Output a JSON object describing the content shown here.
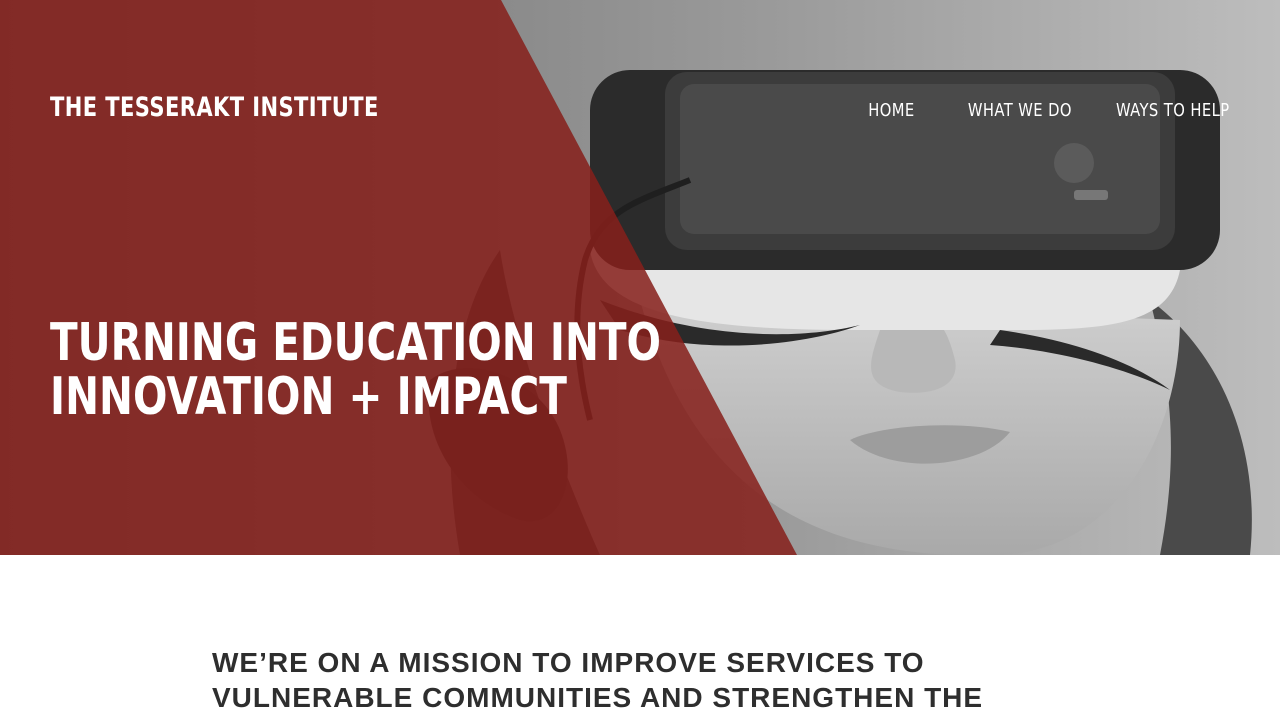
{
  "brand": {
    "logo_text": "THE TESSERAKT INSTITUTE"
  },
  "nav": {
    "items": [
      {
        "label": "HOME"
      },
      {
        "label": "WHAT WE DO"
      },
      {
        "label": "WAYS TO HELP"
      }
    ]
  },
  "hero": {
    "headline_line1": "TURNING EDUCATION INTO",
    "headline_line2": "INNOVATION + IMPACT",
    "image_icon": "vr-headset-photo"
  },
  "mission": {
    "line1": "WE’RE ON A MISSION TO IMPROVE SERVICES TO",
    "line2": "VULNERABLE COMMUNITIES AND STRENGTHEN THE"
  },
  "colors": {
    "brand_red": "#861f1b",
    "text_dark": "#2e2e2e",
    "white": "#ffffff"
  }
}
